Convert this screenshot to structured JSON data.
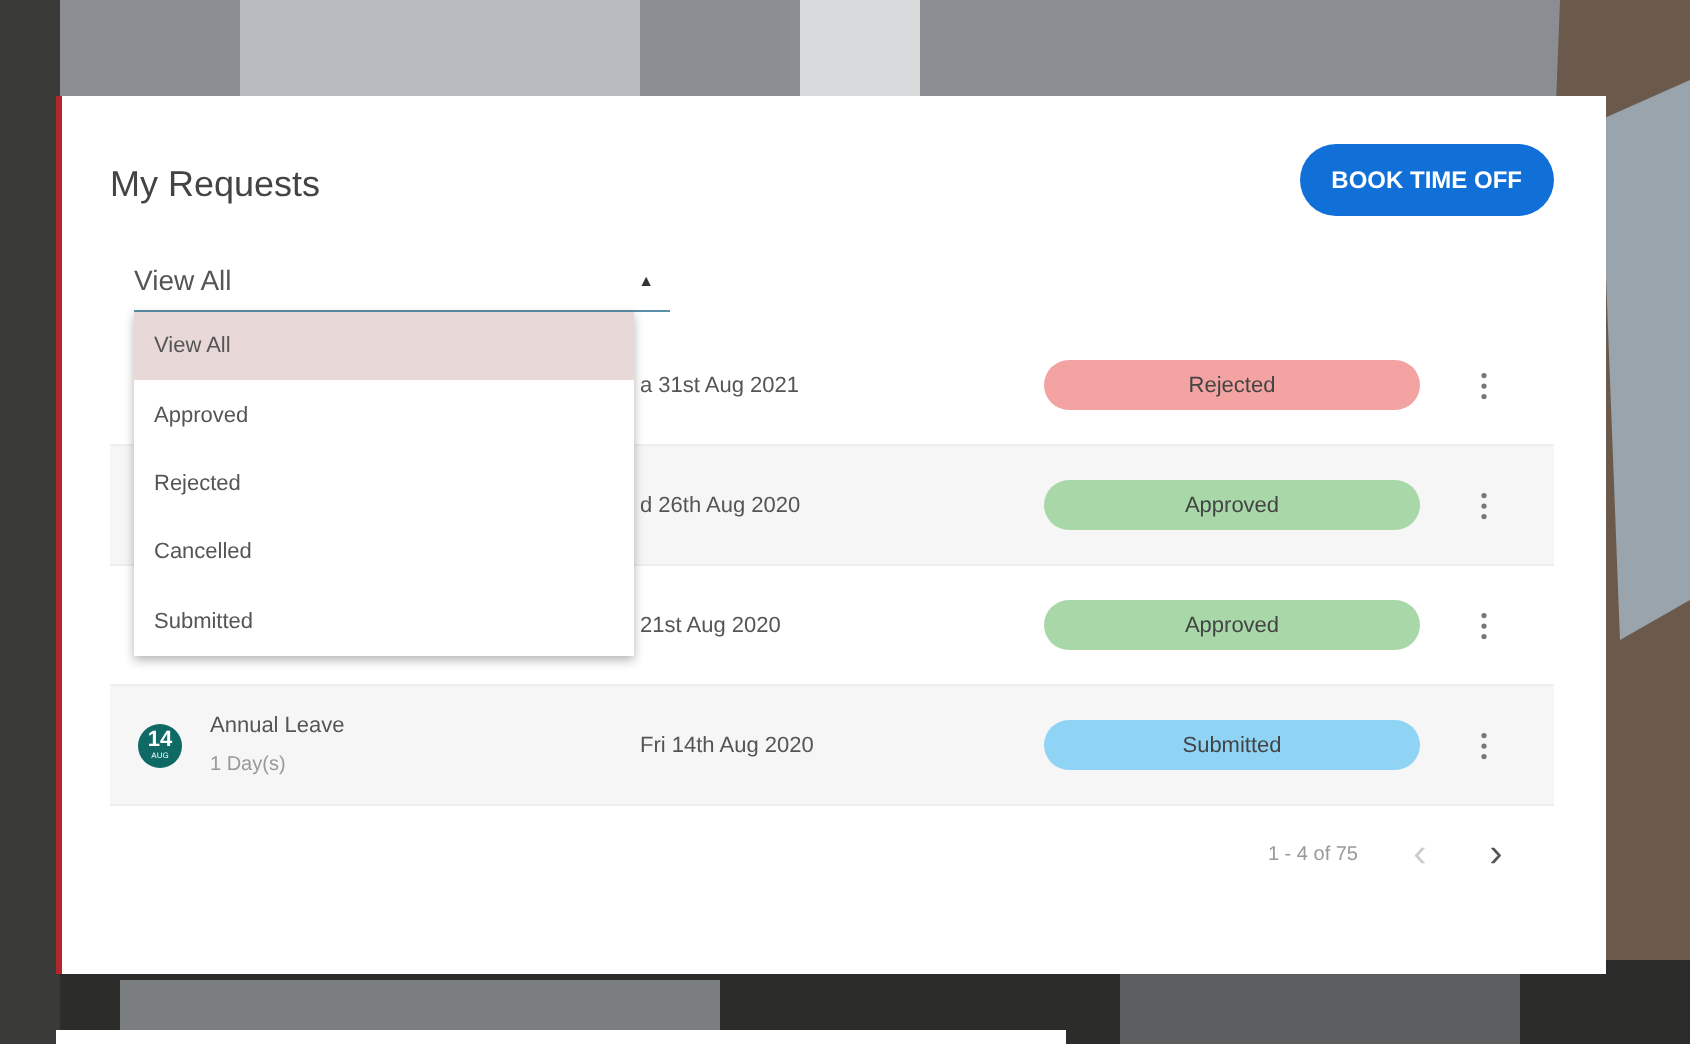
{
  "card": {
    "title": "My Requests",
    "book_button": "BOOK TIME OFF"
  },
  "filter": {
    "value": "View All",
    "caret": "▲",
    "expanded": true,
    "options": [
      {
        "label": "View All",
        "selected": true
      },
      {
        "label": "Approved",
        "selected": false
      },
      {
        "label": "Rejected",
        "selected": false
      },
      {
        "label": "Cancelled",
        "selected": false
      },
      {
        "label": "Submitted",
        "selected": false
      }
    ]
  },
  "rows": [
    {
      "date": "a 31st Aug 2021",
      "status": "Rejected",
      "color": "#f4a3a3"
    },
    {
      "date": "d 26th Aug 2020",
      "status": "Approved",
      "color": "#a8d8a8"
    },
    {
      "date": "21st Aug 2020",
      "status": "Approved",
      "color": "#a8d8a8"
    },
    {
      "day": "14",
      "month": "AUG",
      "type": "Annual Leave",
      "duration": "1 Day(s)",
      "date": "Fri 14th Aug 2020",
      "status": "Submitted",
      "color": "#8fd3f5"
    }
  ],
  "pagination": {
    "range": "1 - 4 of 75",
    "prev": "‹",
    "next": "›",
    "prev_disabled": true
  }
}
